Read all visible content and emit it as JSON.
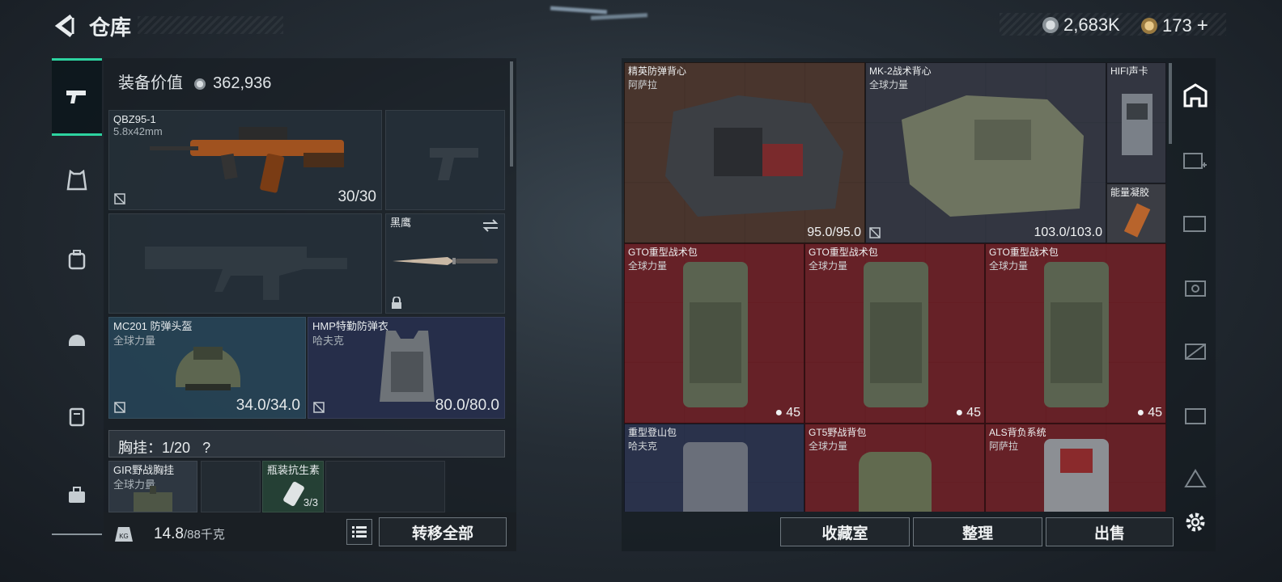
{
  "header": {
    "title": "仓库"
  },
  "currency": {
    "coins": "2,683K",
    "tokens": "173"
  },
  "equipment": {
    "value_label": "装备价值",
    "value": "362,936",
    "primary": {
      "name": "QBZ95-1",
      "ammo": "5.8x42mm",
      "count": "30/30"
    },
    "melee": {
      "name": "黑鹰"
    },
    "helmet": {
      "name": "MC201 防弹头盔",
      "brand": "全球力量",
      "durability": "34.0/34.0"
    },
    "armor": {
      "name": "HMP特勤防弹衣",
      "brand": "哈夫克",
      "durability": "80.0/80.0"
    },
    "chest_rig_label": "胸挂：1/20",
    "chest_rig_help": "?",
    "rig_item": {
      "name": "GIR野战胸挂",
      "brand": "全球力量"
    },
    "rig_content": {
      "name": "瓶装抗生素",
      "count": "3/3"
    }
  },
  "weight": {
    "value": "14.8",
    "max": "/88千克",
    "kg_badge": "KG"
  },
  "buttons": {
    "transfer_all": "转移全部",
    "collection": "收藏室",
    "sort": "整理",
    "sell": "出售"
  },
  "grid_items": [
    {
      "name": "精英防弹背心",
      "brand": "阿萨拉",
      "durability": "95.0/95.0"
    },
    {
      "name": "MK-2战术背心",
      "brand": "全球力量",
      "durability": "103.0/103.0"
    },
    {
      "name": "HIFI声卡"
    },
    {
      "name": "能量凝胶"
    },
    {
      "name": "GTO重型战术包",
      "brand": "全球力量",
      "capacity": "45"
    },
    {
      "name": "GTO重型战术包",
      "brand": "全球力量",
      "capacity": "45"
    },
    {
      "name": "GTO重型战术包",
      "brand": "全球力量",
      "capacity": "45"
    },
    {
      "name": "重型登山包",
      "brand": "哈夫克"
    },
    {
      "name": "GT5野战背包",
      "brand": "全球力量"
    },
    {
      "name": "ALS背负系统",
      "brand": "阿萨拉"
    }
  ],
  "colors": {
    "accent": "#2dd3a0",
    "rare_red": "#6e1e26",
    "rare_brown": "#50372d"
  },
  "icons": [
    "back-arrow-icon",
    "gun-icon",
    "vest-icon",
    "helmet-icon",
    "backpack-icon",
    "case-icon",
    "toolbox-icon",
    "lock-icon",
    "swap-icon",
    "list-icon",
    "gear-icon",
    "home-icon"
  ]
}
